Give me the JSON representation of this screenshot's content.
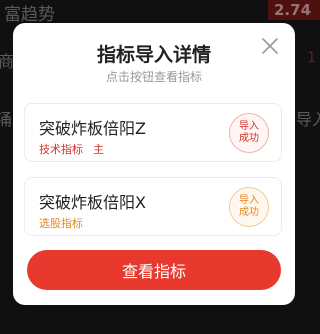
{
  "background": {
    "stock_name": "富趋势",
    "price": "2.74",
    "left_char_1": "商",
    "left_char_2": "涌",
    "right_fragment": "导入",
    "right_digit": "1"
  },
  "dialog": {
    "title": "指标导入详情",
    "subtitle": "点击按钮查看指标",
    "close_icon": "close-icon",
    "cards": [
      {
        "name": "突破炸板倍阳Z",
        "tags": [
          "技术指标",
          "主"
        ],
        "status": [
          "导入",
          "成功"
        ],
        "accent": "#d0342c"
      },
      {
        "name": "突破炸板倍阳X",
        "tags": [
          "选股指标"
        ],
        "status": [
          "导入",
          "成功"
        ],
        "accent": "#e58a1f"
      }
    ],
    "button_label": "查看指标",
    "button_color": "#e8392f"
  }
}
